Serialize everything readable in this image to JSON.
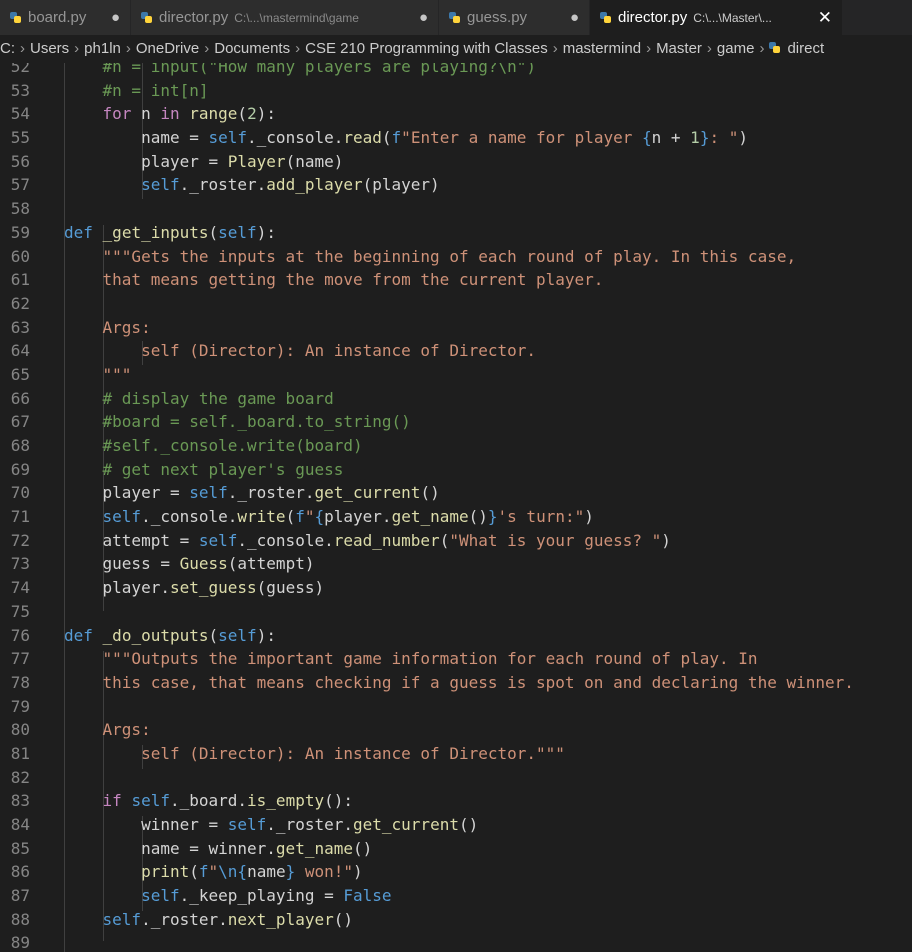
{
  "tabs": [
    {
      "label": "board.py",
      "desc": "",
      "marker": "●",
      "active": false
    },
    {
      "label": "director.py",
      "desc": "C:\\...\\mastermind\\game",
      "marker": "●",
      "active": false
    },
    {
      "label": "guess.py",
      "desc": "",
      "marker": "●",
      "active": false
    },
    {
      "label": "director.py",
      "desc": "C:\\...\\Master\\...",
      "marker": "✕",
      "active": true
    }
  ],
  "breadcrumb": [
    "C:",
    "Users",
    "ph1ln",
    "OneDrive",
    "Documents",
    "CSE 210 Programming with Classes",
    "mastermind",
    "Master",
    "game",
    "direct"
  ],
  "code": [
    {
      "n": "52",
      "t": "    #n = input(\"How many players are playing?\\n\")"
    },
    {
      "n": "53",
      "t": "    #n = int[n]"
    },
    {
      "n": "54",
      "t": "    for n in range(2):"
    },
    {
      "n": "55",
      "t": "        name = self._console.read(f\"Enter a name for player {n + 1}: \")"
    },
    {
      "n": "56",
      "t": "        player = Player(name)"
    },
    {
      "n": "57",
      "t": "        self._roster.add_player(player)"
    },
    {
      "n": "58",
      "t": ""
    },
    {
      "n": "59",
      "t": "def _get_inputs(self):"
    },
    {
      "n": "60",
      "t": "    \"\"\"Gets the inputs at the beginning of each round of play. In this case,"
    },
    {
      "n": "61",
      "t": "    that means getting the move from the current player."
    },
    {
      "n": "62",
      "t": ""
    },
    {
      "n": "63",
      "t": "    Args:"
    },
    {
      "n": "64",
      "t": "        self (Director): An instance of Director."
    },
    {
      "n": "65",
      "t": "    \"\"\""
    },
    {
      "n": "66",
      "t": "    # display the game board"
    },
    {
      "n": "67",
      "t": "    #board = self._board.to_string()"
    },
    {
      "n": "68",
      "t": "    #self._console.write(board)"
    },
    {
      "n": "69",
      "t": "    # get next player's guess"
    },
    {
      "n": "70",
      "t": "    player = self._roster.get_current()"
    },
    {
      "n": "71",
      "t": "    self._console.write(f\"{player.get_name()}'s turn:\")"
    },
    {
      "n": "72",
      "t": "    attempt = self._console.read_number(\"What is your guess? \")"
    },
    {
      "n": "73",
      "t": "    guess = Guess(attempt)"
    },
    {
      "n": "74",
      "t": "    player.set_guess(guess)"
    },
    {
      "n": "75",
      "t": ""
    },
    {
      "n": "76",
      "t": "def _do_outputs(self):"
    },
    {
      "n": "77",
      "t": "    \"\"\"Outputs the important game information for each round of play. In"
    },
    {
      "n": "78",
      "t": "    this case, that means checking if a guess is spot on and declaring the winner."
    },
    {
      "n": "79",
      "t": ""
    },
    {
      "n": "80",
      "t": "    Args:"
    },
    {
      "n": "81",
      "t": "        self (Director): An instance of Director.\"\"\""
    },
    {
      "n": "82",
      "t": ""
    },
    {
      "n": "83",
      "t": "    if self._board.is_empty():"
    },
    {
      "n": "84",
      "t": "        winner = self._roster.get_current()"
    },
    {
      "n": "85",
      "t": "        name = winner.get_name()"
    },
    {
      "n": "86",
      "t": "        print(f\"\\n{name} won!\")"
    },
    {
      "n": "87",
      "t": "        self._keep_playing = False"
    },
    {
      "n": "88",
      "t": "    self._roster.next_player()"
    },
    {
      "n": "89",
      "t": ""
    }
  ]
}
